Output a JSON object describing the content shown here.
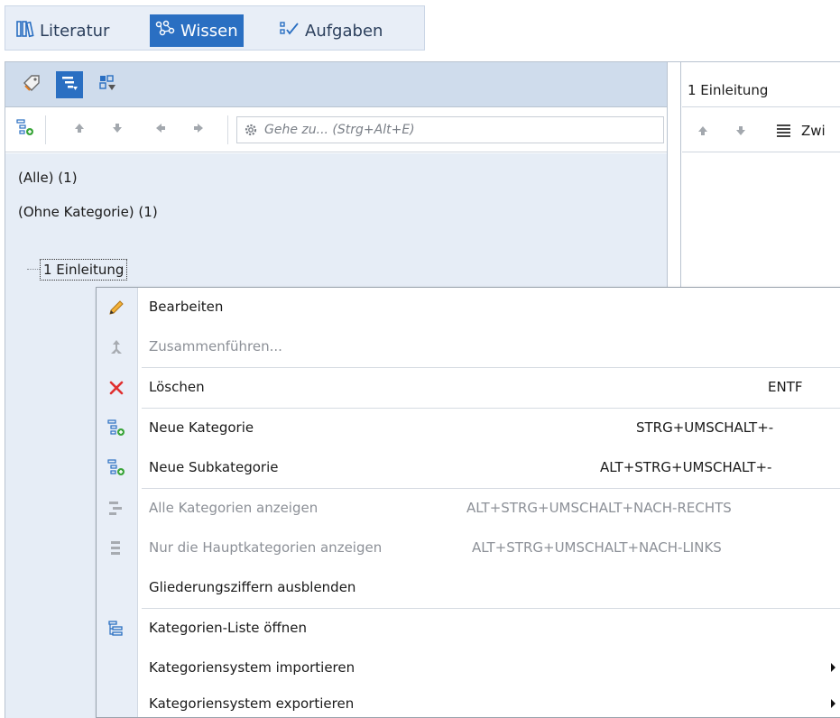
{
  "nav": {
    "tabs": [
      {
        "label": "Literatur",
        "icon": "books-icon",
        "active": false
      },
      {
        "label": "Wissen",
        "icon": "knowledge-network-icon",
        "active": true
      },
      {
        "label": "Aufgaben",
        "icon": "tasks-icon",
        "active": false
      }
    ]
  },
  "left_panel": {
    "toolbar": {
      "goto_placeholder": "Gehe zu... (Strg+Alt+E)"
    },
    "tree": {
      "items": [
        {
          "label": "(Alle) (1)"
        },
        {
          "label": "(Ohne Kategorie) (1)"
        },
        {
          "label": "1 Einleitung"
        }
      ]
    }
  },
  "right_panel": {
    "title": "1 Einleitung",
    "toolbar_text": "Zwi"
  },
  "context_menu": {
    "items": [
      {
        "label": "Bearbeiten",
        "shortcut": "",
        "icon": "pencil-icon",
        "enabled": true
      },
      {
        "label": "Zusammenführen...",
        "shortcut": "",
        "icon": "merge-icon",
        "enabled": false
      },
      {
        "label": "Löschen",
        "shortcut": "ENTF",
        "icon": "delete-x-icon",
        "enabled": true
      },
      {
        "label": "Neue Kategorie",
        "shortcut": "STRG+UMSCHALT+-",
        "icon": "add-category-icon",
        "enabled": true
      },
      {
        "label": "Neue Subkategorie",
        "shortcut": "ALT+STRG+UMSCHALT+-",
        "icon": "add-subcategory-icon",
        "enabled": true
      },
      {
        "label": "Alle Kategorien anzeigen",
        "shortcut": "ALT+STRG+UMSCHALT+NACH-RECHTS",
        "icon": "expand-categories-icon",
        "enabled": false
      },
      {
        "label": "Nur die Hauptkategorien anzeigen",
        "shortcut": "ALT+STRG+UMSCHALT+NACH-LINKS",
        "icon": "collapse-categories-icon",
        "enabled": false
      },
      {
        "label": "Gliederungsziffern ausblenden",
        "shortcut": "",
        "icon": "",
        "enabled": true
      },
      {
        "label": "Kategorien-Liste öffnen",
        "shortcut": "",
        "icon": "category-list-icon",
        "enabled": true
      },
      {
        "label": "Kategoriensystem importieren",
        "shortcut": "",
        "icon": "",
        "enabled": true,
        "submenu": true
      },
      {
        "label": "Kategoriensystem exportieren",
        "shortcut": "",
        "icon": "",
        "enabled": true,
        "submenu": true
      }
    ]
  },
  "colors": {
    "accent": "#2a6fc2",
    "panel_header": "#cfdcec",
    "tree_bg": "#e6edf6",
    "disabled_text": "#8c9097",
    "delete_red": "#e03030",
    "add_green": "#3aa53a"
  }
}
